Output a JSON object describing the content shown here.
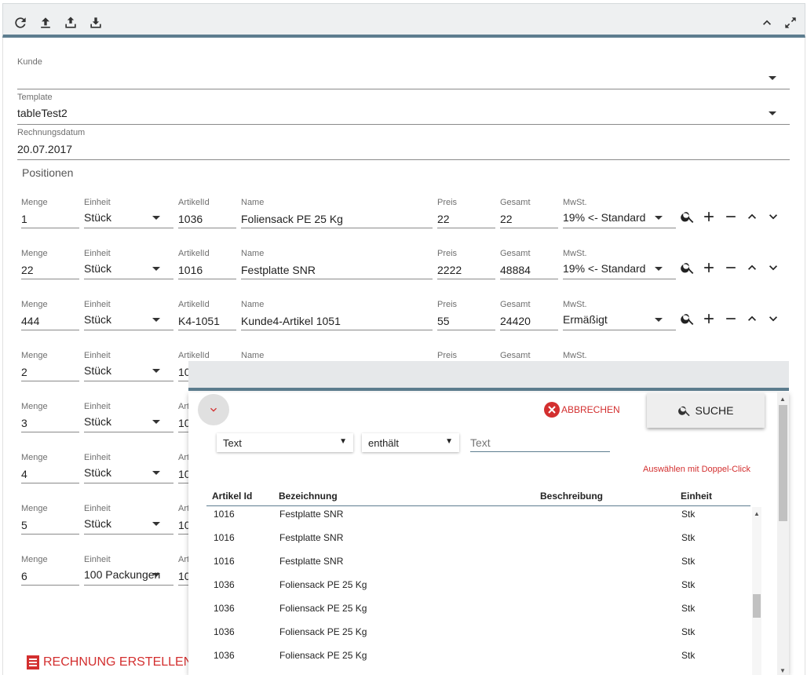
{
  "toolbar": {
    "icons": [
      "refresh-icon",
      "upload-icon",
      "upload-tray-icon",
      "download-tray-icon",
      "chevron-up-icon",
      "expand-icon"
    ]
  },
  "form": {
    "kunde": {
      "label": "Kunde",
      "value": ""
    },
    "template": {
      "label": "Template",
      "value": "tableTest2"
    },
    "rechnungsdatum": {
      "label": "Rechnungsdatum",
      "value": "20.07.2017"
    },
    "positionen_title": "Positionen"
  },
  "columns": {
    "menge": "Menge",
    "einheit": "Einheit",
    "artikelid": "ArtikelId",
    "name": "Name",
    "preis": "Preis",
    "gesamt": "Gesamt",
    "mwst": "MwSt."
  },
  "positions": [
    {
      "menge": "1",
      "einheit": "Stück",
      "artikelid": "1036",
      "name": "Foliensack PE 25 Kg",
      "preis": "22",
      "gesamt": "22",
      "mwst": "19% <- Standard"
    },
    {
      "menge": "22",
      "einheit": "Stück",
      "artikelid": "1016",
      "name": "Festplatte SNR",
      "preis": "2222",
      "gesamt": "48884",
      "mwst": "19% <- Standard"
    },
    {
      "menge": "444",
      "einheit": "Stück",
      "artikelid": "K4-1051",
      "name": "Kunde4-Artikel 1051",
      "preis": "55",
      "gesamt": "24420",
      "mwst": "Ermäßigt"
    },
    {
      "menge": "2",
      "einheit": "Stück",
      "artikelid": "10",
      "name": "",
      "preis": "",
      "gesamt": "",
      "mwst": ""
    },
    {
      "menge": "3",
      "einheit": "Stück",
      "artikelid": "10",
      "name": "",
      "preis": "",
      "gesamt": "",
      "mwst": ""
    },
    {
      "menge": "4",
      "einheit": "Stück",
      "artikelid": "10",
      "name": "",
      "preis": "",
      "gesamt": "",
      "mwst": ""
    },
    {
      "menge": "5",
      "einheit": "Stück",
      "artikelid": "10",
      "name": "",
      "preis": "",
      "gesamt": "",
      "mwst": ""
    },
    {
      "menge": "6",
      "einheit": "100 Packungen",
      "artikelid": "10",
      "name": "",
      "preis": "",
      "gesamt": "",
      "mwst": ""
    }
  ],
  "labels_partial": {
    "artikelid": "Art"
  },
  "create_invoice_label": "RECHNUNG ERSTELLEN",
  "search_dialog": {
    "cancel_label": "ABBRECHEN",
    "search_label": "SUCHE",
    "filter_field": "Text",
    "filter_op": "enthält",
    "filter_placeholder": "Text",
    "hint": "Auswählen mit Doppel-Click",
    "headers": [
      "Artikel Id",
      "Bezeichnung",
      "Beschreibung",
      "Einheit"
    ],
    "rows": [
      {
        "id": "1016",
        "bez": "Festplatte SNR",
        "besch": "",
        "einheit": "Stk"
      },
      {
        "id": "1016",
        "bez": "Festplatte SNR",
        "besch": "",
        "einheit": "Stk"
      },
      {
        "id": "1016",
        "bez": "Festplatte SNR",
        "besch": "",
        "einheit": "Stk"
      },
      {
        "id": "1036",
        "bez": "Foliensack PE 25 Kg",
        "besch": "",
        "einheit": "Stk"
      },
      {
        "id": "1036",
        "bez": "Foliensack PE 25 Kg",
        "besch": "",
        "einheit": "Stk"
      },
      {
        "id": "1036",
        "bez": "Foliensack PE 25 Kg",
        "besch": "",
        "einheit": "Stk"
      },
      {
        "id": "1036",
        "bez": "Foliensack PE 25 Kg",
        "besch": "",
        "einheit": "Stk"
      }
    ]
  },
  "colors": {
    "accent": "#5d7d8f",
    "danger": "#d32f2f"
  }
}
